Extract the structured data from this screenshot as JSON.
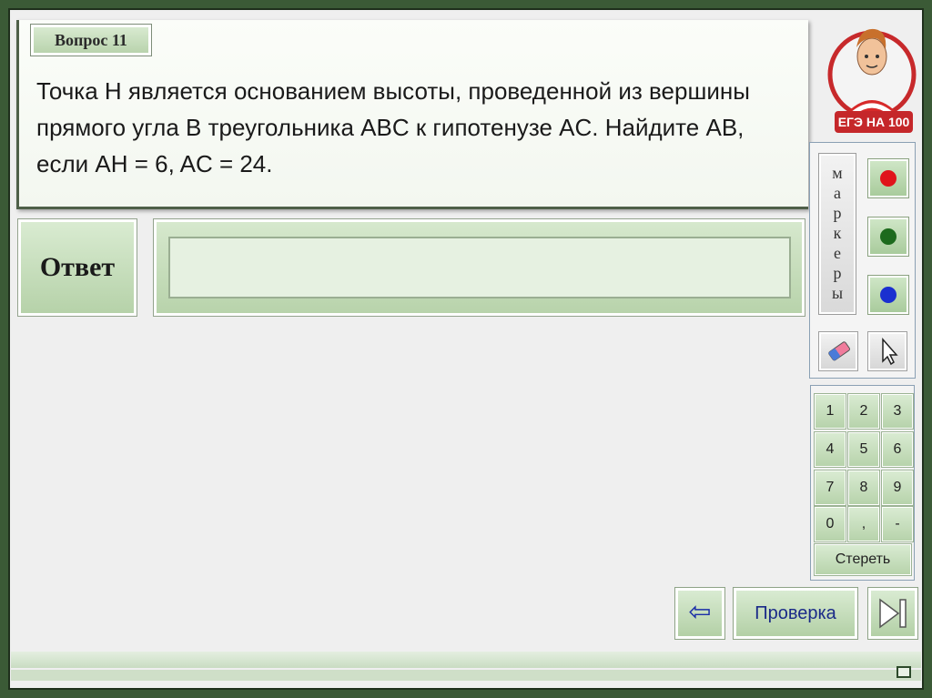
{
  "question": {
    "badge": "Вопрос 11",
    "text": "Точка H является основанием высоты, проведенной из вершины прямого угла B треугольника ABC к гипотенузе AC. Найдите AB, если AH = 6, AC = 24."
  },
  "answer": {
    "label": "Ответ",
    "value": ""
  },
  "logo": {
    "text": "ЕГЭ НА 100"
  },
  "markers": {
    "label_letters": [
      "м",
      "а",
      "р",
      "к",
      "е",
      "р",
      "ы"
    ],
    "colors": {
      "red": "#e0141b",
      "green": "#1d6a1d",
      "blue": "#1a2fd0"
    }
  },
  "keypad": {
    "keys": [
      "1",
      "2",
      "3",
      "4",
      "5",
      "6",
      "7",
      "8",
      "9",
      "0",
      ",",
      "-"
    ],
    "erase_label": "Стереть"
  },
  "nav": {
    "check_label": "Проверка",
    "back_icon": "⇦"
  }
}
